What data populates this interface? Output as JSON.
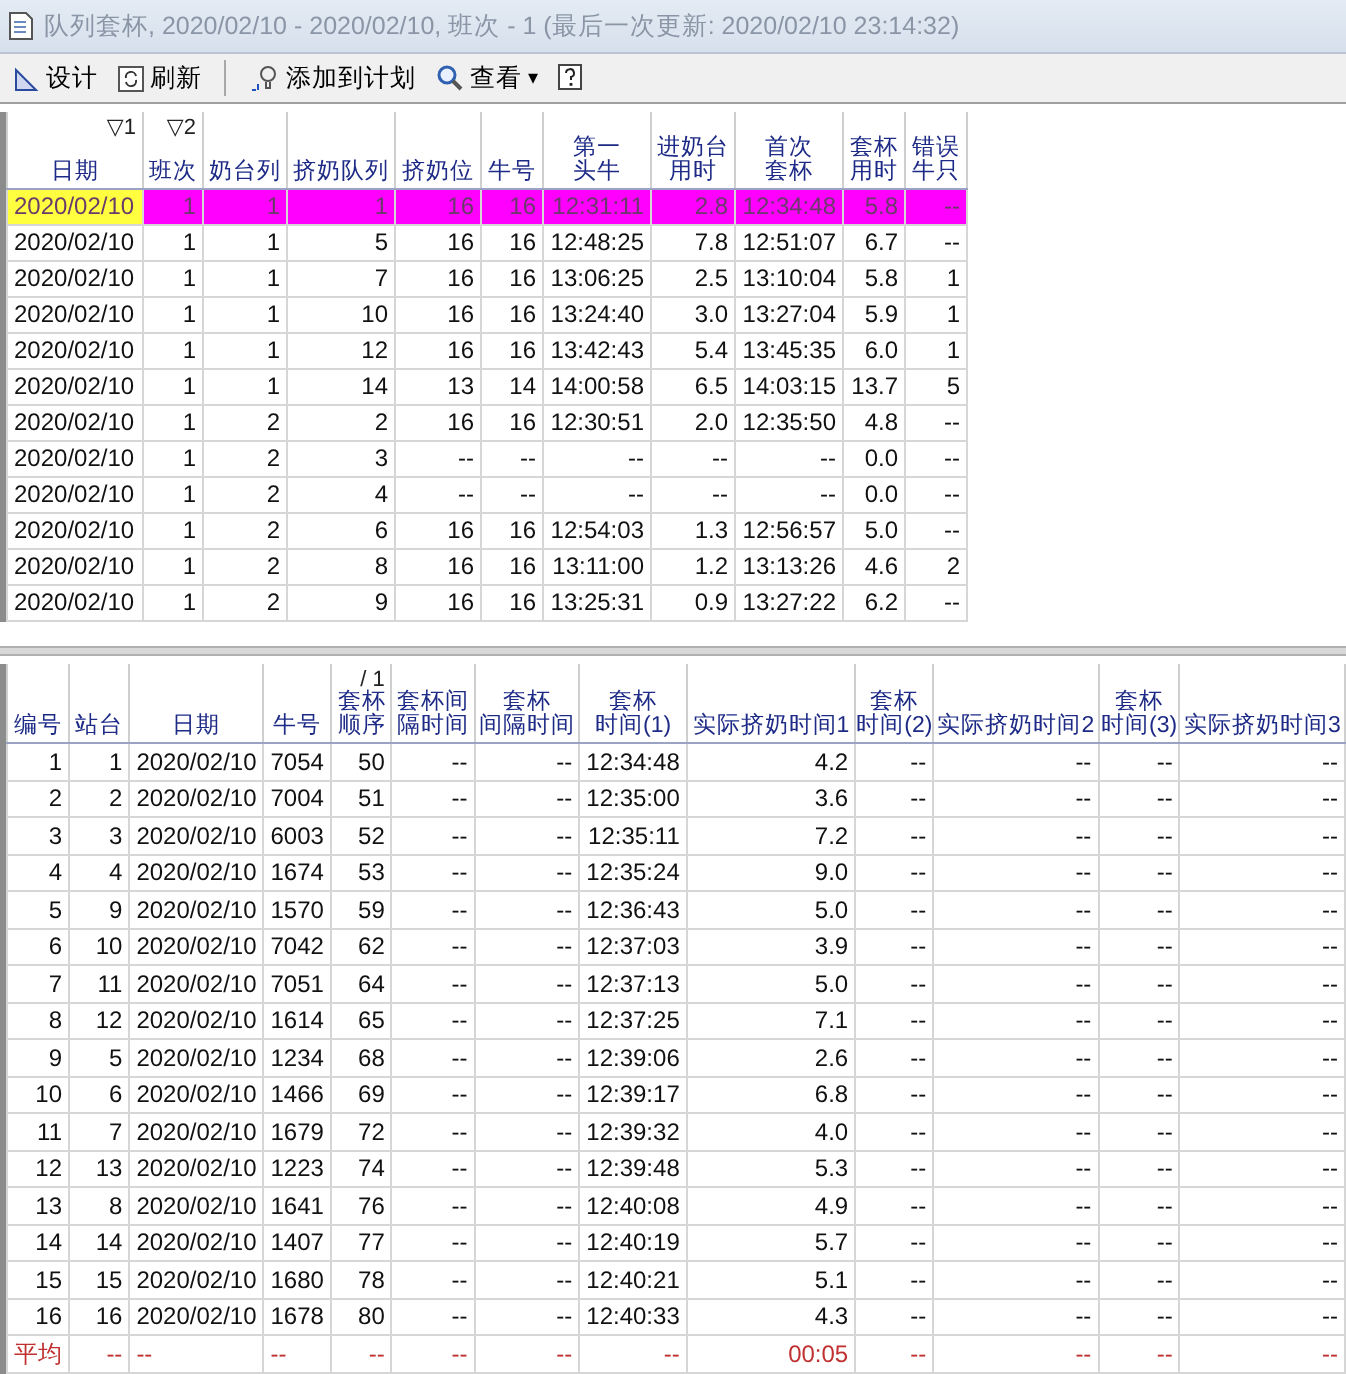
{
  "window": {
    "title": "队列套杯, 2020/02/10 - 2020/02/10, 班次 - 1 (最后一次更新: 2020/02/10 23:14:32)"
  },
  "toolbar": [
    {
      "kind": "design",
      "label": "设计"
    },
    {
      "kind": "refresh",
      "label": "刷新"
    },
    {
      "kind": "separator"
    },
    {
      "kind": "plan",
      "label": "添加到计划"
    },
    {
      "kind": "view",
      "label": "查看",
      "caret": "▾"
    },
    {
      "kind": "help"
    }
  ],
  "queue_table": {
    "columns": [
      {
        "label": "日期",
        "sort": "▽1"
      },
      {
        "label": "班次",
        "sort": "▽2"
      },
      {
        "label": "奶台列"
      },
      {
        "label": "挤奶队列"
      },
      {
        "label": "挤奶位"
      },
      {
        "label": "牛号"
      },
      {
        "label": "第一头牛"
      },
      {
        "label": "进奶台用时"
      },
      {
        "label": "首次套杯"
      },
      {
        "label": "套杯用时"
      },
      {
        "label": "错误牛只"
      }
    ],
    "rows": [
      {
        "selected": true,
        "cells": [
          "2020/02/10",
          "1",
          "1",
          "1",
          "16",
          "16",
          "12:31:11",
          "2.8",
          "12:34:48",
          "5.8",
          "--"
        ]
      },
      {
        "selected": false,
        "cells": [
          "2020/02/10",
          "1",
          "1",
          "5",
          "16",
          "16",
          "12:48:25",
          "7.8",
          "12:51:07",
          "6.7",
          "--"
        ]
      },
      {
        "selected": false,
        "cells": [
          "2020/02/10",
          "1",
          "1",
          "7",
          "16",
          "16",
          "13:06:25",
          "2.5",
          "13:10:04",
          "5.8",
          "1"
        ]
      },
      {
        "selected": false,
        "cells": [
          "2020/02/10",
          "1",
          "1",
          "10",
          "16",
          "16",
          "13:24:40",
          "3.0",
          "13:27:04",
          "5.9",
          "1"
        ]
      },
      {
        "selected": false,
        "cells": [
          "2020/02/10",
          "1",
          "1",
          "12",
          "16",
          "16",
          "13:42:43",
          "5.4",
          "13:45:35",
          "6.0",
          "1"
        ]
      },
      {
        "selected": false,
        "cells": [
          "2020/02/10",
          "1",
          "1",
          "14",
          "13",
          "14",
          "14:00:58",
          "6.5",
          "14:03:15",
          "13.7",
          "5"
        ]
      },
      {
        "selected": false,
        "cells": [
          "2020/02/10",
          "1",
          "2",
          "2",
          "16",
          "16",
          "12:30:51",
          "2.0",
          "12:35:50",
          "4.8",
          "--"
        ]
      },
      {
        "selected": false,
        "cells": [
          "2020/02/10",
          "1",
          "2",
          "3",
          "--",
          "--",
          "--",
          "--",
          "--",
          "0.0",
          "--"
        ]
      },
      {
        "selected": false,
        "cells": [
          "2020/02/10",
          "1",
          "2",
          "4",
          "--",
          "--",
          "--",
          "--",
          "--",
          "0.0",
          "--"
        ]
      },
      {
        "selected": false,
        "cells": [
          "2020/02/10",
          "1",
          "2",
          "6",
          "16",
          "16",
          "12:54:03",
          "1.3",
          "12:56:57",
          "5.0",
          "--"
        ]
      },
      {
        "selected": false,
        "cells": [
          "2020/02/10",
          "1",
          "2",
          "8",
          "16",
          "16",
          "13:11:00",
          "1.2",
          "13:13:26",
          "4.6",
          "2"
        ]
      },
      {
        "selected": false,
        "cells": [
          "2020/02/10",
          "1",
          "2",
          "9",
          "16",
          "16",
          "13:25:31",
          "0.9",
          "13:27:22",
          "6.2",
          "--"
        ]
      }
    ]
  },
  "attach_table": {
    "columns": [
      {
        "label": "编号"
      },
      {
        "label": "站台"
      },
      {
        "label": "日期"
      },
      {
        "label": "牛号"
      },
      {
        "label": "套杯顺序",
        "sort": "/ 1"
      },
      {
        "label": "套杯间隔时间"
      },
      {
        "label": "套杯间隔时间"
      },
      {
        "label": "套杯时间(1)"
      },
      {
        "label": "实际挤奶时间1"
      },
      {
        "label": "套杯时间(2)"
      },
      {
        "label": "实际挤奶时间2"
      },
      {
        "label": "套杯时间(3)"
      },
      {
        "label": "实际挤奶时间3"
      }
    ],
    "rows": [
      {
        "kind": "data",
        "cells": [
          "1",
          "1",
          "2020/02/10",
          "7054",
          "50",
          "--",
          "--",
          "12:34:48",
          "4.2",
          "--",
          "--",
          "--",
          "--"
        ]
      },
      {
        "kind": "data",
        "cells": [
          "2",
          "2",
          "2020/02/10",
          "7004",
          "51",
          "--",
          "--",
          "12:35:00",
          "3.6",
          "--",
          "--",
          "--",
          "--"
        ]
      },
      {
        "kind": "data",
        "cells": [
          "3",
          "3",
          "2020/02/10",
          "6003",
          "52",
          "--",
          "--",
          "12:35:11",
          "7.2",
          "--",
          "--",
          "--",
          "--"
        ]
      },
      {
        "kind": "data",
        "cells": [
          "4",
          "4",
          "2020/02/10",
          "1674",
          "53",
          "--",
          "--",
          "12:35:24",
          "9.0",
          "--",
          "--",
          "--",
          "--"
        ]
      },
      {
        "kind": "data",
        "cells": [
          "5",
          "9",
          "2020/02/10",
          "1570",
          "59",
          "--",
          "--",
          "12:36:43",
          "5.0",
          "--",
          "--",
          "--",
          "--"
        ]
      },
      {
        "kind": "data",
        "cells": [
          "6",
          "10",
          "2020/02/10",
          "7042",
          "62",
          "--",
          "--",
          "12:37:03",
          "3.9",
          "--",
          "--",
          "--",
          "--"
        ]
      },
      {
        "kind": "data",
        "cells": [
          "7",
          "11",
          "2020/02/10",
          "7051",
          "64",
          "--",
          "--",
          "12:37:13",
          "5.0",
          "--",
          "--",
          "--",
          "--"
        ]
      },
      {
        "kind": "data",
        "cells": [
          "8",
          "12",
          "2020/02/10",
          "1614",
          "65",
          "--",
          "--",
          "12:37:25",
          "7.1",
          "--",
          "--",
          "--",
          "--"
        ]
      },
      {
        "kind": "data",
        "cells": [
          "9",
          "5",
          "2020/02/10",
          "1234",
          "68",
          "--",
          "--",
          "12:39:06",
          "2.6",
          "--",
          "--",
          "--",
          "--"
        ]
      },
      {
        "kind": "data",
        "cells": [
          "10",
          "6",
          "2020/02/10",
          "1466",
          "69",
          "--",
          "--",
          "12:39:17",
          "6.8",
          "--",
          "--",
          "--",
          "--"
        ]
      },
      {
        "kind": "data",
        "cells": [
          "11",
          "7",
          "2020/02/10",
          "1679",
          "72",
          "--",
          "--",
          "12:39:32",
          "4.0",
          "--",
          "--",
          "--",
          "--"
        ]
      },
      {
        "kind": "data",
        "cells": [
          "12",
          "13",
          "2020/02/10",
          "1223",
          "74",
          "--",
          "--",
          "12:39:48",
          "5.3",
          "--",
          "--",
          "--",
          "--"
        ]
      },
      {
        "kind": "data",
        "cells": [
          "13",
          "8",
          "2020/02/10",
          "1641",
          "76",
          "--",
          "--",
          "12:40:08",
          "4.9",
          "--",
          "--",
          "--",
          "--"
        ]
      },
      {
        "kind": "data",
        "cells": [
          "14",
          "14",
          "2020/02/10",
          "1407",
          "77",
          "--",
          "--",
          "12:40:19",
          "5.7",
          "--",
          "--",
          "--",
          "--"
        ]
      },
      {
        "kind": "data",
        "cells": [
          "15",
          "15",
          "2020/02/10",
          "1680",
          "78",
          "--",
          "--",
          "12:40:21",
          "5.1",
          "--",
          "--",
          "--",
          "--"
        ]
      },
      {
        "kind": "data",
        "cells": [
          "16",
          "16",
          "2020/02/10",
          "1678",
          "80",
          "--",
          "--",
          "12:40:33",
          "4.3",
          "--",
          "--",
          "--",
          "--"
        ]
      },
      {
        "kind": "summary",
        "cells": [
          "平均",
          "--",
          "--",
          "--",
          "--",
          "--",
          "--",
          "--",
          "00:05",
          "--",
          "--",
          "--",
          "--"
        ]
      }
    ]
  }
}
